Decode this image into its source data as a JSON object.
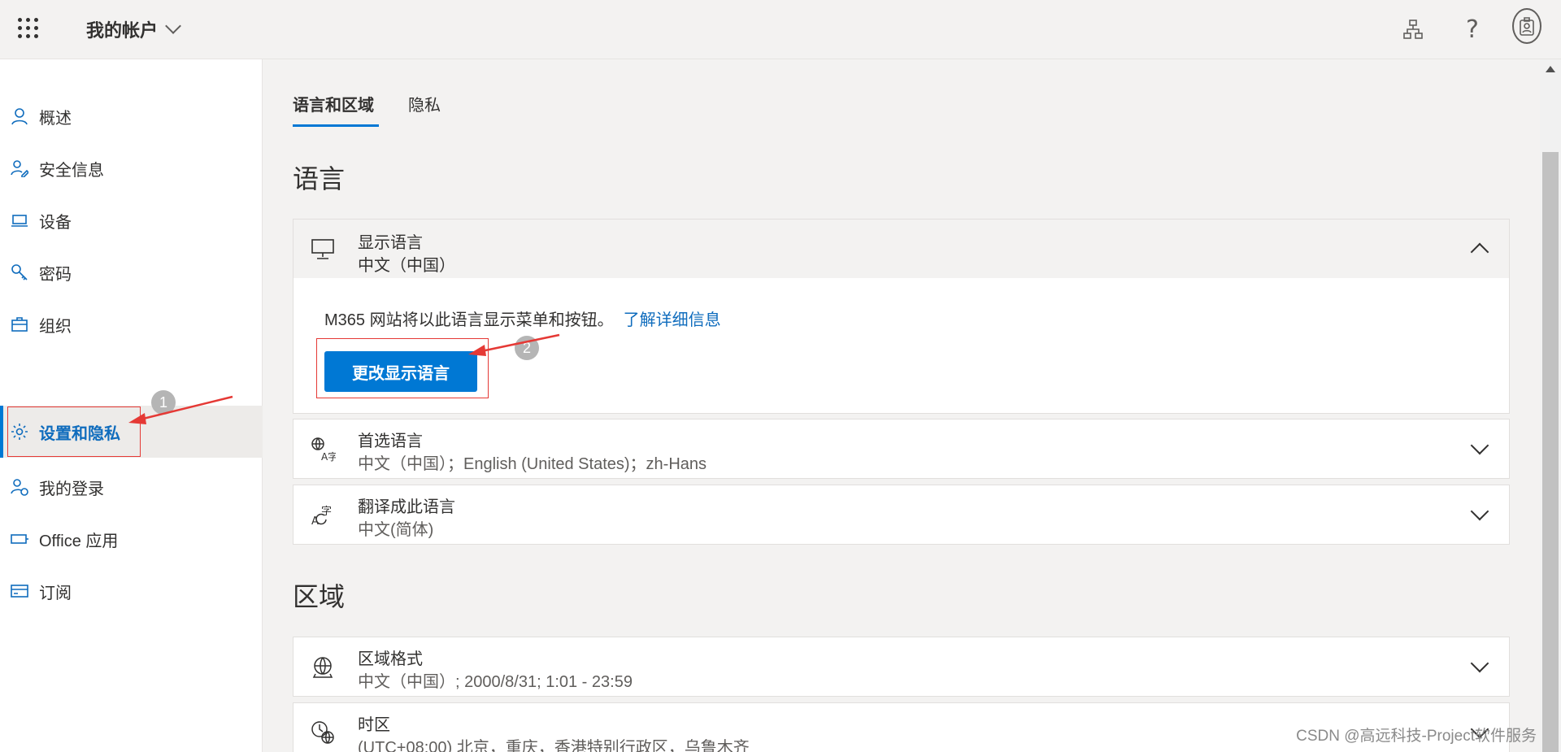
{
  "header": {
    "title": "我的帐户",
    "icons": [
      "app-launcher-icon",
      "org-chart-icon",
      "help-icon",
      "account-avatar-icon"
    ],
    "help_glyph": "?"
  },
  "sidebar": {
    "items": [
      {
        "label": "概述",
        "icon": "person-icon"
      },
      {
        "label": "安全信息",
        "icon": "security-info-icon"
      },
      {
        "label": "设备",
        "icon": "laptop-icon"
      },
      {
        "label": "密码",
        "icon": "key-icon"
      },
      {
        "label": "组织",
        "icon": "briefcase-icon"
      },
      {
        "label": "设置和隐私",
        "icon": "gear-icon",
        "active": true
      },
      {
        "label": "我的登录",
        "icon": "sign-ins-icon"
      },
      {
        "label": "Office 应用",
        "icon": "office-apps-icon"
      },
      {
        "label": "订阅",
        "icon": "credit-card-icon"
      }
    ]
  },
  "main": {
    "tabs": [
      {
        "label": "语言和区域",
        "active": true
      },
      {
        "label": "隐私",
        "active": false
      }
    ],
    "language_section": {
      "title": "语言",
      "display_language": {
        "title": "显示语言",
        "value": "中文（中国）",
        "description": "M365 网站将以此语言显示菜单和按钮。",
        "learn_more": "了解详细信息",
        "button": "更改显示语言"
      },
      "preferred_languages": {
        "title": "首选语言",
        "value": "中文（中国）；English (United States)；zh-Hans"
      },
      "translate_to": {
        "title": "翻译成此语言",
        "value": "中文(简体)"
      }
    },
    "region_section": {
      "title": "区域",
      "regional_format": {
        "title": "区域格式",
        "value": "中文（中国）; 2000/8/31; 1:01 - 23:59"
      },
      "time_zone": {
        "title": "时区",
        "value": "(UTC+08:00) 北京，重庆，香港特别行政区，乌鲁木齐"
      }
    }
  },
  "annotations": {
    "badge1": "1",
    "badge2": "2",
    "color": "#e53935"
  },
  "watermark": "CSDN @高远科技-Project软件服务",
  "colors": {
    "accent": "#0078d4",
    "link": "#0f6cbd",
    "annotation": "#e53935"
  }
}
